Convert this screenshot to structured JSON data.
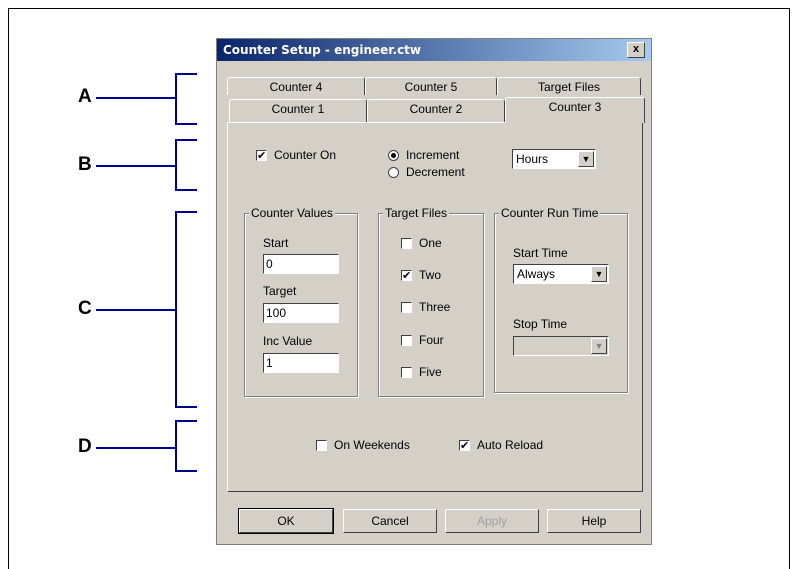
{
  "annotations": [
    "A",
    "B",
    "C",
    "D"
  ],
  "dialog": {
    "title": "Counter Setup - engineer.ctw",
    "close_label": "x",
    "tabs_back": [
      "Counter 4",
      "Counter 5",
      "Target Files"
    ],
    "tabs_front": [
      "Counter 1",
      "Counter 2",
      "Counter 3"
    ],
    "active_tab": "Counter 3"
  },
  "row_b": {
    "counter_on_label": "Counter On",
    "counter_on_checked": true,
    "increment_label": "Increment",
    "decrement_label": "Decrement",
    "selected_mode": "Increment",
    "units_value": "Hours"
  },
  "counter_values": {
    "title": "Counter Values",
    "start_label": "Start",
    "start_value": "0",
    "target_label": "Target",
    "target_value": "100",
    "inc_label": "Inc Value",
    "inc_value": "1"
  },
  "target_files": {
    "title": "Target Files",
    "items": [
      {
        "label": "One",
        "checked": false
      },
      {
        "label": "Two",
        "checked": true
      },
      {
        "label": "Three",
        "checked": false
      },
      {
        "label": "Four",
        "checked": false
      },
      {
        "label": "Five",
        "checked": false
      }
    ]
  },
  "run_time": {
    "title": "Counter Run Time",
    "start_label": "Start Time",
    "start_value": "Always",
    "stop_label": "Stop Time",
    "stop_value": ""
  },
  "row_d": {
    "weekends_label": "On Weekends",
    "weekends_checked": false,
    "auto_reload_label": "Auto Reload",
    "auto_reload_checked": true
  },
  "buttons": {
    "ok": "OK",
    "cancel": "Cancel",
    "apply": "Apply",
    "help": "Help"
  },
  "colors": {
    "annotation_line": "#00008b",
    "dialog_face": "#d4d0c8",
    "titlebar_start": "#0a246a"
  }
}
